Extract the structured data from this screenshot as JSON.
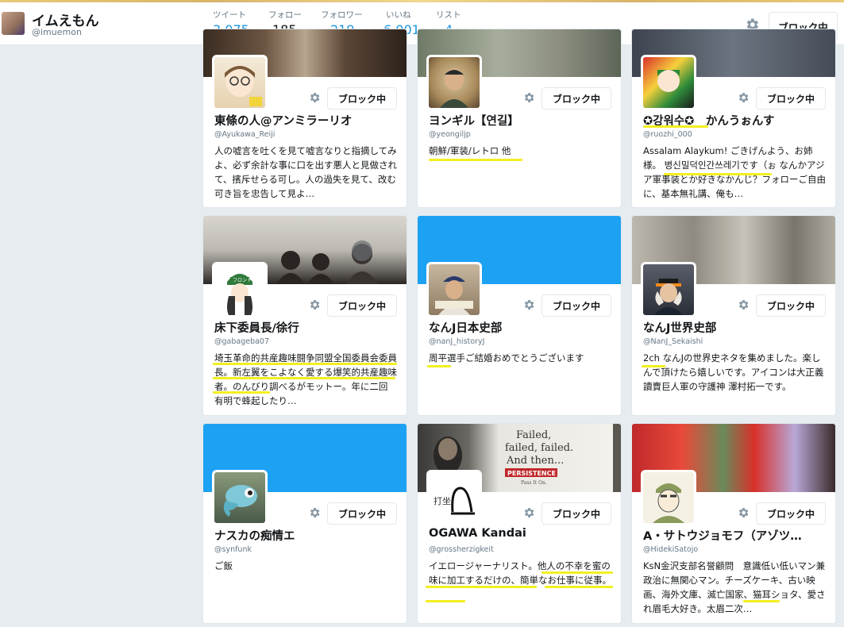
{
  "header": {
    "name": "イムえもん",
    "handle": "@imuemon",
    "block_label": "ブロック中",
    "stats": [
      {
        "label": "ツイート",
        "value": "3,075"
      },
      {
        "label": "フォロー",
        "value": "185"
      },
      {
        "label": "フォロワー",
        "value": "219"
      },
      {
        "label": "いいね",
        "value": "6,001"
      },
      {
        "label": "リスト",
        "value": "4"
      }
    ]
  },
  "cards": [
    {
      "name": "東條の人@アンミラーリオ",
      "handle": "@Ayukawa_Reiji",
      "block": "ブロック中",
      "bio": "人の嘘言を吐くを見て嘘言なりと指摘してみよ、必ず余計な事に口を出す悪人と見做されて、擯斥せらる可し。人の過失を見て、改む可き旨を忠告して見よ…"
    },
    {
      "name": "ヨンギル【연길】",
      "handle": "@yeongiljp",
      "block": "ブロック中",
      "bio": "朝鮮/軍装/レトロ 他"
    },
    {
      "name": "✪강워수✪　かんうぉんす",
      "handle": "@ruozhi_000",
      "block": "ブロック中",
      "bio": "Assalam Alaykum! ごきげんよう、お姉様。 병신밀덕인간쓰레기です（ぉ なんかアジア軍事装とか好きなかんじ？フォローご自由に、基本無礼講、俺も…"
    },
    {
      "name": "床下委員長/徐行",
      "handle": "@gabageba07",
      "block": "ブロック中",
      "bio": "埼玉革命的共産趣味闘争同盟全国委員会委員長。新左翼をこよなく愛する爆笑的共産趣味者。のんびり調べるがモットー。年に二回　　有明で蜂起したり…"
    },
    {
      "name": "なんJ日本史部",
      "handle": "@nanJ_historyJ",
      "block": "ブロック中",
      "bio": "周平選手ご結婚おめでとうございます"
    },
    {
      "name": "なんJ世界史部",
      "handle": "@NanJ_Sekaishi",
      "block": "ブロック中",
      "bio": "2ch なんJの世界史ネタを集めました。楽しんで頂けたら嬉しいです。アイコンは大正義讀賣巨人軍の守護神 澤村拓一です。"
    },
    {
      "name": "ナスカの痴情エ",
      "handle": "@synfunk",
      "block": "ブロック中",
      "bio": "ご飯"
    },
    {
      "name": "OGAWA Kandai",
      "handle": "@grossherzigkeit",
      "block": "ブロック中",
      "bio": "イエロージャーナリスト。他人の不幸を蜜の味に加工するだけの、簡単なお仕事に従事。"
    },
    {
      "name": "A・サトウジョモフ（アゾツ…",
      "handle": "@HidekiSatojo",
      "block": "ブロック中",
      "bio": "KsN金沢支部名誉顧問　意識低い低いマン兼政治に無関心マン。チーズケーキ、古い映画、海外文庫、滅亡国家、猫耳ショタ、愛され眉毛大好き。太眉二次…"
    }
  ],
  "banner_texts": {
    "ogawa_line1": "Failed,",
    "ogawa_line2": "failed, failed.",
    "ogawa_line3": "And then...",
    "ogawa_sign": "PERSISTENCE",
    "ogawa_sign_sub": "Pass It On.",
    "gabageba_flag": "フロント",
    "ogawa_avatar": "打坐"
  },
  "colors": {
    "accent": "#1b95e0",
    "highlight": "#f2ef22",
    "banner_blue": "#1da1f2"
  }
}
